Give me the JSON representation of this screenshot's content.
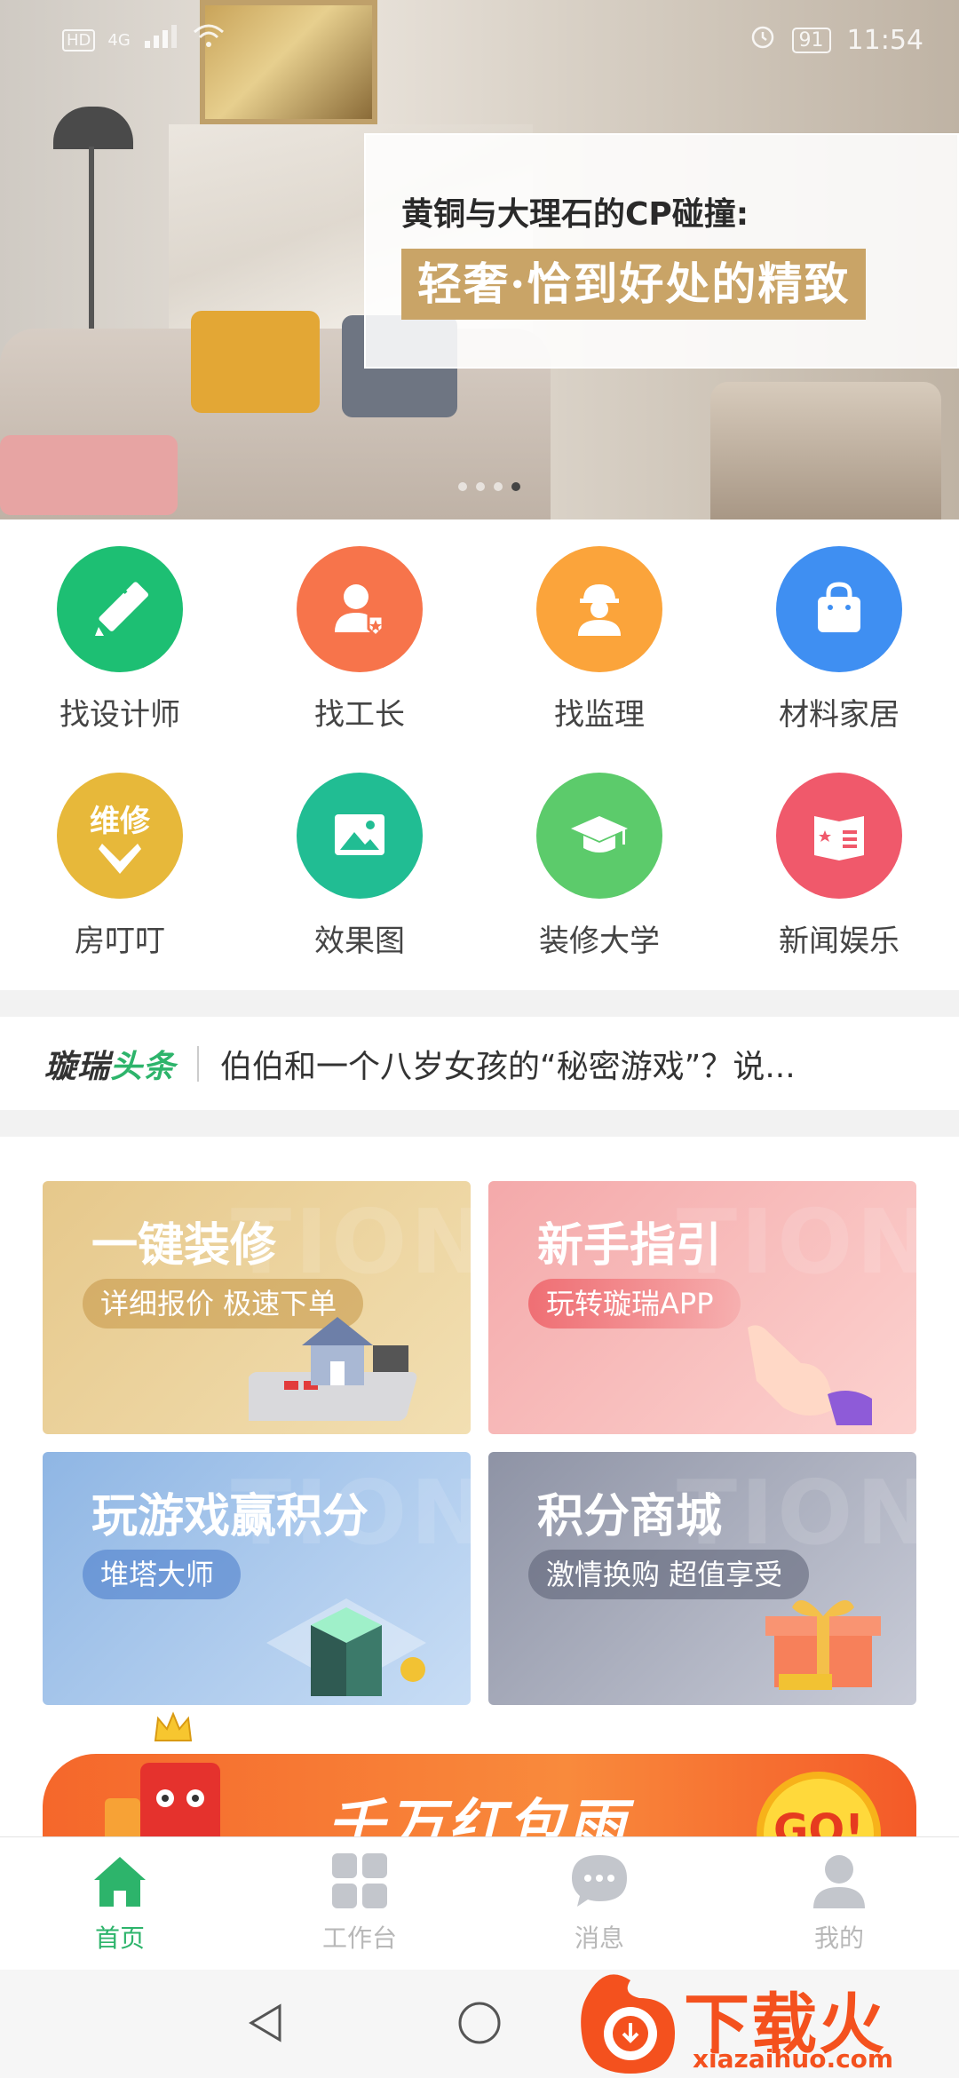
{
  "status_bar": {
    "hd": "HD",
    "network": "4G",
    "battery": "91",
    "time": "11:54"
  },
  "hero": {
    "line1": "黄铜与大理石的CP碰撞:",
    "line2": "轻奢·恰到好处的精致",
    "dots": 4,
    "active_dot": 3
  },
  "grid": {
    "items": [
      {
        "label": "找设计师",
        "icon": "designer-icon",
        "color": "#1dbf73"
      },
      {
        "label": "找工长",
        "icon": "foreman-icon",
        "color": "#f7744b"
      },
      {
        "label": "找监理",
        "icon": "supervisor-icon",
        "color": "#fba43b"
      },
      {
        "label": "材料家居",
        "icon": "shopping-bag-icon",
        "color": "#3f8ff2"
      },
      {
        "label": "房叮叮",
        "icon": "repair-icon",
        "icon_text": "维修",
        "color": "#e7b83a"
      },
      {
        "label": "效果图",
        "icon": "image-icon",
        "color": "#21bd93"
      },
      {
        "label": "装修大学",
        "icon": "graduation-cap-icon",
        "color": "#5ccb6b"
      },
      {
        "label": "新闻娱乐",
        "icon": "news-icon",
        "color": "#f0596b"
      }
    ]
  },
  "headline": {
    "brand_a": "璇瑞",
    "brand_b": "头条",
    "news": "伯伯和一个八岁女孩的“秘密游戏”？说..."
  },
  "cards": [
    {
      "title": "一键装修",
      "pill": "详细报价 极速下单",
      "watermark": "TION"
    },
    {
      "title": "新手指引",
      "pill": "玩转璇瑞APP",
      "watermark": "TION"
    },
    {
      "title": "玩游戏赢积分",
      "pill": "堆塔大师",
      "watermark": "TION"
    },
    {
      "title": "积分商城",
      "pill": "激情换购  超值享受",
      "watermark": "TION"
    }
  ],
  "promo": {
    "text": "千万红包雨",
    "coin_text": "GO!"
  },
  "tabbar": {
    "tabs": [
      {
        "label": "首页",
        "icon": "home-icon",
        "active": true
      },
      {
        "label": "工作台",
        "icon": "grid-icon",
        "active": false
      },
      {
        "label": "消息",
        "icon": "chat-icon",
        "active": false
      },
      {
        "label": "我的",
        "icon": "user-icon",
        "active": false
      }
    ]
  },
  "watermark": {
    "title": "下载火",
    "url": "xiazaihuo.com"
  },
  "colors": {
    "accent": "#2db46b",
    "tab_inactive": "#b8b8b8"
  }
}
